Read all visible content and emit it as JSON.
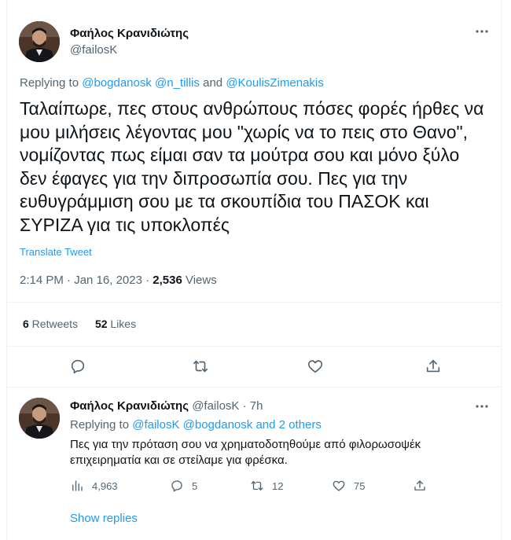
{
  "main_tweet": {
    "author_name": "Φαήλος Κρανιδιώτης",
    "author_handle": "@failosK",
    "more_icon": "ellipsis-icon",
    "replying_prefix": "Replying to ",
    "replying_mentions": [
      "@bogdanosk",
      "@n_tillis",
      "@KoulisZimenakis"
    ],
    "replying_and": " and ",
    "text": "Ταλαίπωρε, πες στους ανθρώπους πόσες φορές ήρθες να μου μιλήσεις λέγοντας μου \"χωρίς να το πεις στο Θανο\", νομίζοντας πως είμαι σαν τα μούτρα σου και μόνο ξύλο δεν έφαγες για την διπροσωπία σου. Πες για την ευθυγράμμιση σου με τα σκουπίδια του ΠΑΣΟΚ και ΣΥΡΙΖΑ για τις υποκλοπές",
    "translate_label": "Translate Tweet",
    "timestamp": "2:14 PM · Jan 16, 2023 · ",
    "views_count": "2,536",
    "views_label": " Views",
    "retweets_count": "6",
    "retweets_label": " Retweets",
    "likes_count": "52",
    "likes_label": " Likes",
    "actions": [
      "reply-icon",
      "retweet-icon",
      "like-icon",
      "share-icon"
    ]
  },
  "reply_tweet": {
    "author_name": "Φαήλος Κρανιδιώτης",
    "author_handle": "@failosK",
    "separator": " · ",
    "time": "7h",
    "more_icon": "ellipsis-icon",
    "replying_prefix": "Replying to ",
    "replying_mentions": [
      "@failosK",
      "@bogdanosk"
    ],
    "replying_others": "and 2 others",
    "text": "Πες για την πρόταση σου να χρηματοδοτηθούμε από φιλορωσοψέκ επιχειρηματία και σε στείλαμε για φρέσκα.",
    "views": "4,963",
    "replies": "5",
    "retweets": "12",
    "likes": "75",
    "show_replies_label": "Show replies"
  },
  "colors": {
    "accent": "#1d9bf0",
    "text_primary": "#0f1419",
    "text_secondary": "#536471",
    "divider": "#eff3f4"
  }
}
